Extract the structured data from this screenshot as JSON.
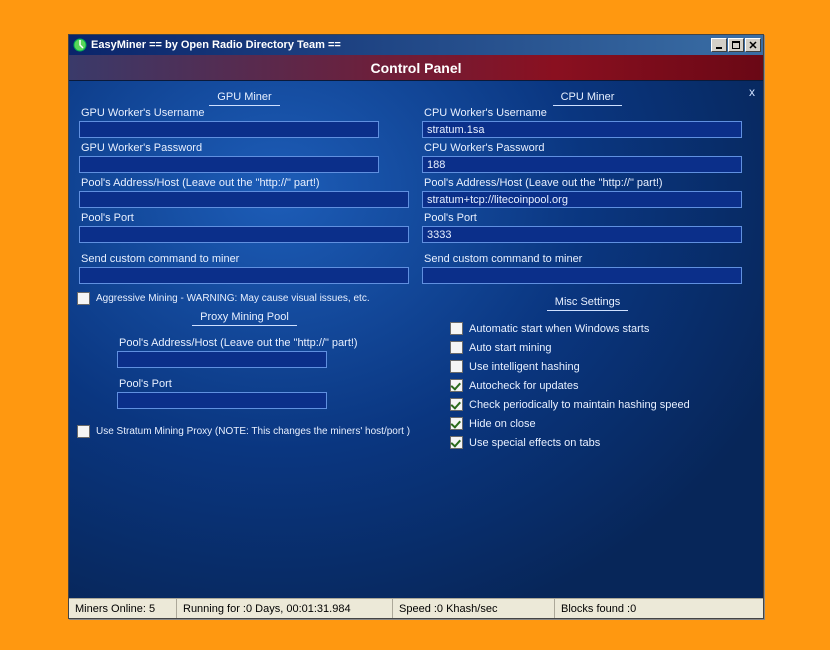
{
  "window": {
    "title": "EasyMiner == by Open Radio Directory Team =="
  },
  "panel": {
    "header": "Control Panel",
    "close_x": "x"
  },
  "gpu": {
    "section": "GPU Miner",
    "labels": {
      "username": "GPU Worker's Username",
      "password": "GPU Worker's Password",
      "host": "Pool's Address/Host (Leave out the \"http://\" part!)",
      "port": "Pool's Port",
      "custom": "Send custom command to miner"
    },
    "values": {
      "username": "",
      "password": "",
      "host": "",
      "port": "",
      "custom": ""
    },
    "aggressive_label": "Aggressive Mining - WARNING: May cause visual issues, etc.",
    "aggressive_checked": false
  },
  "cpu": {
    "section": "CPU Miner",
    "labels": {
      "username": "CPU Worker's Username",
      "password": "CPU Worker's Password",
      "host": "Pool's Address/Host (Leave out the \"http://\" part!)",
      "port": "Pool's Port",
      "custom": "Send custom command to miner"
    },
    "values": {
      "username": "stratum.1sa",
      "password": "188",
      "host": "stratum+tcp://litecoinpool.org",
      "port": "3333",
      "custom": ""
    }
  },
  "proxy": {
    "section": "Proxy Mining Pool",
    "labels": {
      "host": "Pool's Address/Host (Leave out the \"http://\" part!)",
      "port": "Pool's Port"
    },
    "values": {
      "host": "",
      "port": ""
    },
    "use_stratum_label": "Use Stratum Mining Proxy (NOTE: This changes the miners' host/port )",
    "use_stratum_checked": false
  },
  "misc": {
    "section": "Misc Settings",
    "items": [
      {
        "label": "Automatic start when Windows starts",
        "checked": false
      },
      {
        "label": "Auto start mining",
        "checked": false
      },
      {
        "label": "Use intelligent hashing",
        "checked": false
      },
      {
        "label": "Autocheck for updates",
        "checked": true
      },
      {
        "label": "Check periodically to maintain hashing speed",
        "checked": true
      },
      {
        "label": "Hide on close",
        "checked": true
      },
      {
        "label": "Use special effects on tabs",
        "checked": true
      }
    ]
  },
  "status": {
    "miners_online": "Miners Online: 5",
    "running": "Running for :0 Days, 00:01:31.984",
    "speed": "Speed :0 Khash/sec",
    "blocks": "Blocks found :0"
  }
}
